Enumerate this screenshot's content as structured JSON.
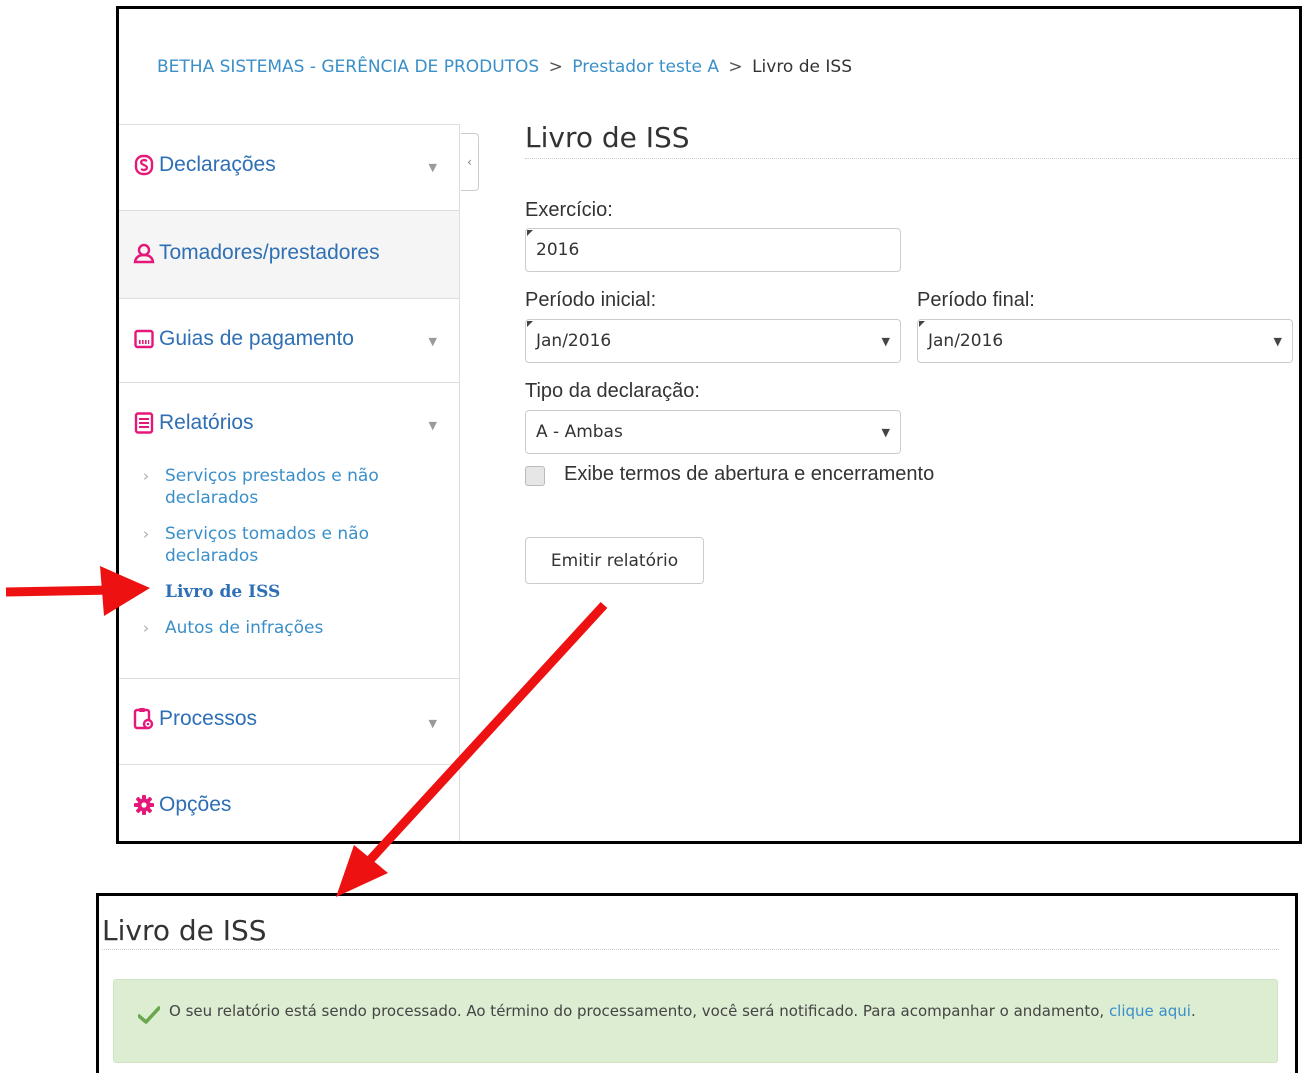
{
  "breadcrumb": {
    "item1": "BETHA SISTEMAS - GERÊNCIA DE PRODUTOS",
    "item2": "Prestador teste A",
    "current": "Livro de ISS",
    "separator": ">"
  },
  "sidebar": {
    "collapse_glyph": "‹",
    "caret_glyph": "▼",
    "sections": [
      {
        "label": "Declarações",
        "icon": "dollar-icon",
        "color": "#e5187a"
      },
      {
        "label": "Tomadores/prestadores",
        "icon": "user-icon",
        "color": "#e5187a"
      },
      {
        "label": "Guias de pagamento",
        "icon": "barcode-icon",
        "color": "#e5187a"
      },
      {
        "label": "Relatórios",
        "icon": "report-icon",
        "color": "#e5187a"
      },
      {
        "label": "Processos",
        "icon": "clipboard-gear-icon",
        "color": "#e5187a"
      },
      {
        "label": "Opções",
        "icon": "gear-icon",
        "color": "#e5187a"
      }
    ],
    "reports_submenu": [
      {
        "label": "Serviços prestados e não declarados"
      },
      {
        "label": "Serviços tomados e não declarados"
      },
      {
        "label": "Livro de ISS",
        "active": true
      },
      {
        "label": "Autos de infrações"
      }
    ],
    "chevron_glyph": "›"
  },
  "main": {
    "title": "Livro de ISS",
    "exercicio_label": "Exercício:",
    "exercicio_value": "2016",
    "periodo_inicial_label": "Período inicial:",
    "periodo_inicial_value": "Jan/2016",
    "periodo_final_label": "Período final:",
    "periodo_final_value": "Jan/2016",
    "tipo_label": "Tipo da declaração:",
    "tipo_value": "A - Ambas",
    "checkbox_label": "Exibe termos de abertura e encerramento",
    "emit_button": "Emitir relatório"
  },
  "result": {
    "title": "Livro de ISS",
    "message": "O seu relatório está sendo processado. Ao término do processamento, você será notificado. Para acompanhar o andamento,",
    "link": "clique aqui",
    "link_suffix": "."
  },
  "colors": {
    "accent_pink": "#e5187a",
    "link_blue": "#3a8fc8",
    "nav_blue": "#2e6fb5",
    "success_bg": "#dcedd2",
    "arrow_red": "#ee1111"
  }
}
